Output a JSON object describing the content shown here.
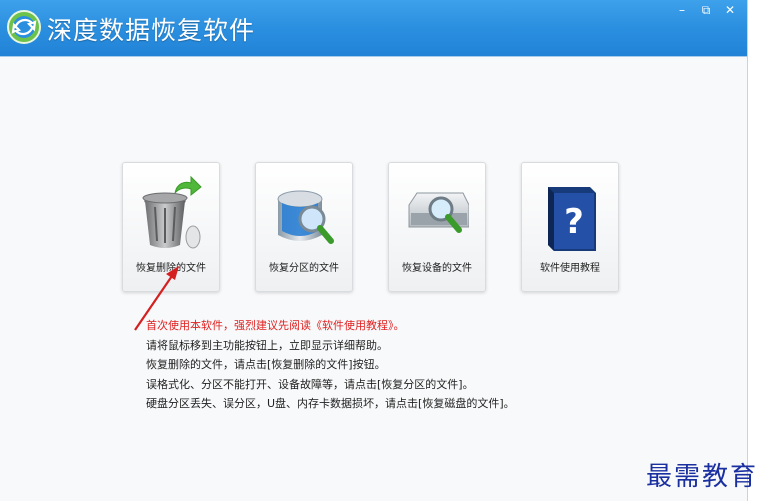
{
  "app": {
    "title": "深度数据恢复软件"
  },
  "window_controls": {
    "minimize": "–",
    "restore": "⧉",
    "close": "✕"
  },
  "buttons": [
    {
      "id": "recover-deleted",
      "label": "恢复删除的文件"
    },
    {
      "id": "recover-partition",
      "label": "恢复分区的文件"
    },
    {
      "id": "recover-device",
      "label": "恢复设备的文件"
    },
    {
      "id": "tutorial",
      "label": "软件使用教程"
    }
  ],
  "help": {
    "notice": "首次使用本软件，强烈建议先阅读《软件使用教程》。",
    "lines": [
      "请将鼠标移到主功能按钮上，立即显示详细帮助。",
      "恢复删除的文件，请点击[恢复删除的文件]按钮。",
      "误格式化、分区不能打开、设备故障等，请点击[恢复分区的文件]。",
      "硬盘分区丢失、误分区，U盘、内存卡数据损坏，请点击[恢复磁盘的文件]。"
    ]
  },
  "watermark": "最需教育",
  "colors": {
    "titlebar": "#2b8fe0",
    "notice": "#e02020",
    "arrow": "#d42020"
  },
  "icons": {
    "logo": "app-logo-icon",
    "recover-deleted": "recycle-bin-icon",
    "recover-partition": "disk-magnifier-icon",
    "recover-device": "hard-drive-magnifier-icon",
    "tutorial": "help-book-icon"
  }
}
